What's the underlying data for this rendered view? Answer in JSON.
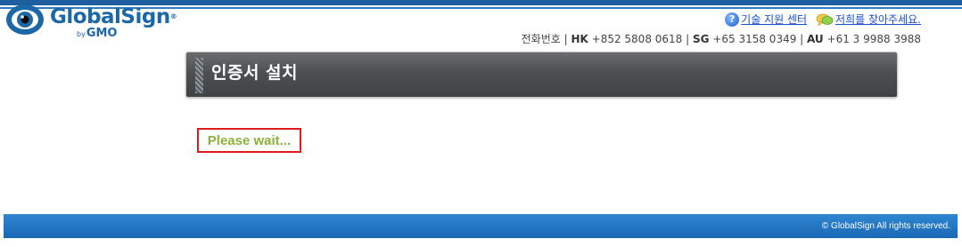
{
  "brand": {
    "name": "GlobalSign",
    "registered": "®",
    "by": "by",
    "parent": "GMO",
    "blue": "#1c67a8"
  },
  "header": {
    "links": [
      {
        "label": "기술 지원 센터",
        "icon": "help-icon"
      },
      {
        "label": "저희를 찾아주세요.",
        "icon": "chat-bubbles-icon"
      }
    ],
    "phone_label": "전화번호",
    "phones": [
      {
        "region": "HK",
        "number": "+852 5808 0618"
      },
      {
        "region": "SG",
        "number": "+65 3158 0349"
      },
      {
        "region": "AU",
        "number": "+61 3 9988 3988"
      }
    ]
  },
  "main": {
    "title": "인증서 설치",
    "status_text": "Please wait...",
    "status_color": "#8bb23a",
    "status_border": "#e01b1b"
  },
  "footer": {
    "copyright": "© GlobalSign All rights reserved."
  }
}
